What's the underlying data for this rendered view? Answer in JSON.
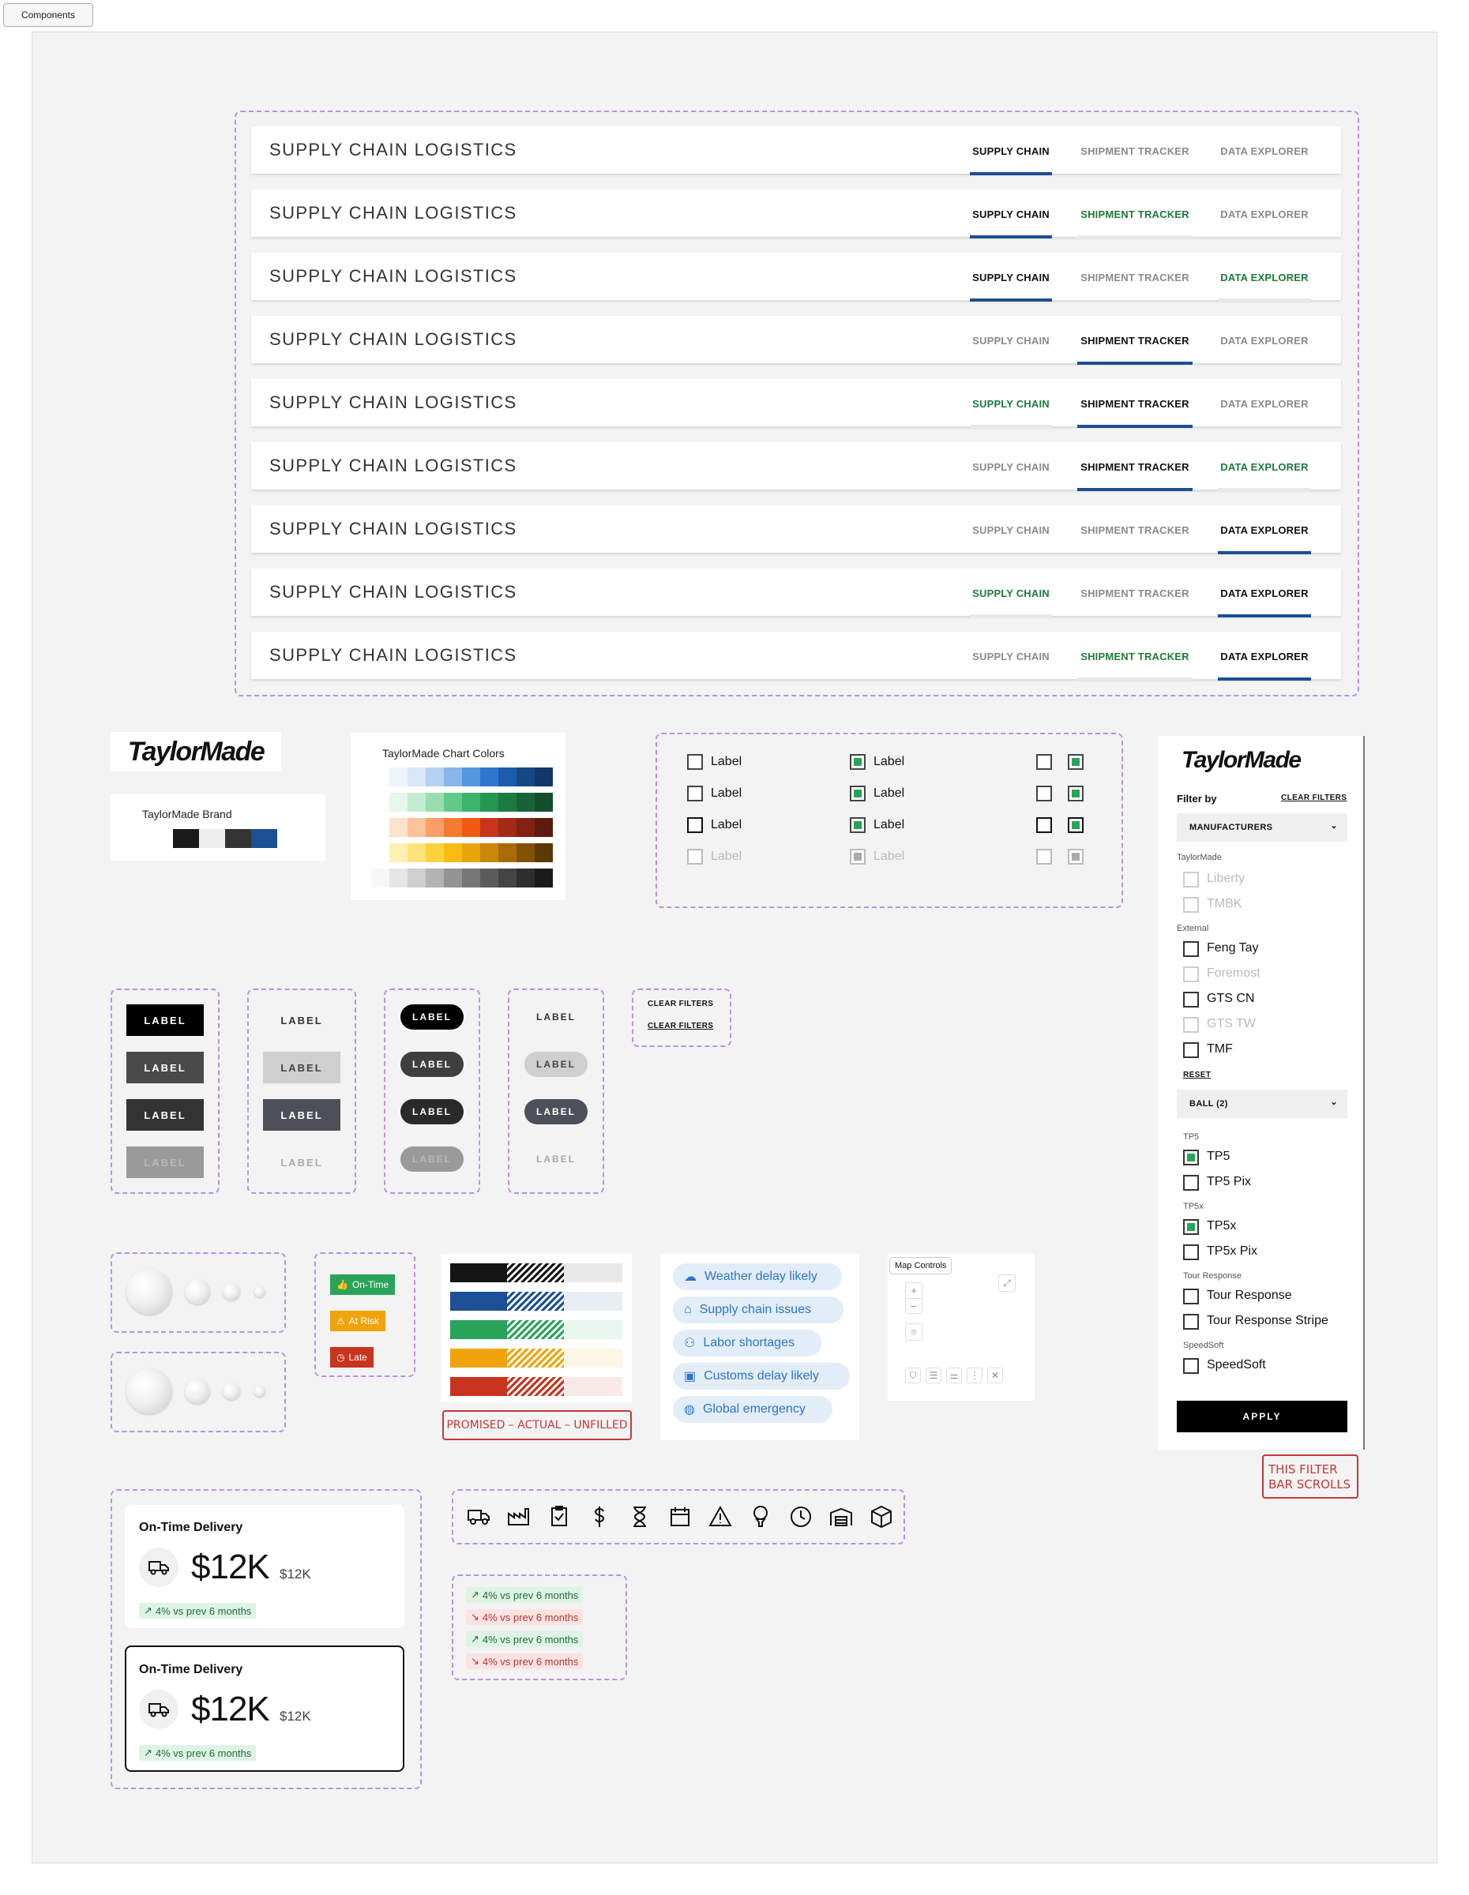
{
  "frame_tag": "Components",
  "nav": {
    "title": "SUPPLY CHAIN LOGISTICS",
    "tabs": [
      "SUPPLY CHAIN",
      "SHIPMENT TRACKER",
      "DATA EXPLORER"
    ],
    "variants": [
      {
        "states": [
          "active",
          "default",
          "default"
        ]
      },
      {
        "states": [
          "active",
          "hover",
          "default"
        ]
      },
      {
        "states": [
          "active",
          "default",
          "hover"
        ]
      },
      {
        "states": [
          "default",
          "active",
          "default"
        ]
      },
      {
        "states": [
          "hover",
          "active",
          "default"
        ]
      },
      {
        "states": [
          "default",
          "active",
          "hover"
        ]
      },
      {
        "states": [
          "default",
          "default",
          "active"
        ]
      },
      {
        "states": [
          "hover",
          "default",
          "active"
        ]
      },
      {
        "states": [
          "default",
          "hover",
          "active"
        ]
      }
    ]
  },
  "brand": {
    "logo_text": "TaylorMade",
    "brand_label": "TaylorMade Brand",
    "brand_colors": [
      "#ffffff",
      "#1a1a1a",
      "#eeeeee",
      "#333333",
      "#1c4f94"
    ],
    "chart_colors_label": "TaylorMade Chart Colors",
    "chart_palette": [
      [
        "#eef4fc",
        "#d8e6f8",
        "#b6d2f2",
        "#89b6ea",
        "#5597de",
        "#2d77cf",
        "#1c5cab",
        "#174886",
        "#12386a"
      ],
      [
        "#e6f7ec",
        "#c5ecd2",
        "#98dcb0",
        "#63c98a",
        "#3ab468",
        "#23964f",
        "#1d7a41",
        "#186336",
        "#134e2b"
      ],
      [
        "#fde2cc",
        "#fbc29c",
        "#f99e66",
        "#f57b31",
        "#f05a12",
        "#c8341d",
        "#a32a15",
        "#7f2211",
        "#5d1a0d"
      ],
      [
        "#fff0b3",
        "#ffe27a",
        "#fdd13e",
        "#f7bc14",
        "#e8a40b",
        "#cc8609",
        "#a86b07",
        "#815106",
        "#5a3904"
      ],
      [
        "#f7f7f7",
        "#e6e6e6",
        "#cfcfcf",
        "#b3b3b3",
        "#949494",
        "#777777",
        "#5c5c5c",
        "#444444",
        "#2e2e2e",
        "#1a1a1a"
      ]
    ]
  },
  "checkboxes": {
    "label": "Label"
  },
  "buttons": {
    "label": "LABEL",
    "clear_filters": "CLEAR FILTERS"
  },
  "status": {
    "on_time": "On-Time",
    "at_risk": "At Risk",
    "late": "Late"
  },
  "bars": {
    "colors": [
      "#151515",
      "#1c4f94",
      "#2aa35a",
      "#f0a30a",
      "#c8341d"
    ],
    "legend_note": "PROMISED – ACTUAL – UNFILLED"
  },
  "risks": [
    {
      "label": "Weather delay likely",
      "icon": "cloud-lightning-icon"
    },
    {
      "label": "Supply chain issues",
      "icon": "factory-icon"
    },
    {
      "label": "Labor shortages",
      "icon": "people-icon"
    },
    {
      "label": "Customs delay likely",
      "icon": "clipboard-icon"
    },
    {
      "label": "Global emergency",
      "icon": "globe-icon"
    }
  ],
  "map_controls": {
    "label": "Map Controls",
    "zoom_in": "+",
    "zoom_out": "–"
  },
  "filter": {
    "logo_text": "TaylorMade",
    "filter_by": "Filter by",
    "clear": "CLEAR FILTERS",
    "manufacturers": "MANUFACTURERS",
    "group_taylormade": "TaylorMade",
    "liberty": "Liberty",
    "tmbk": "TMBK",
    "group_external": "External",
    "feng_tay": "Feng Tay",
    "foremost": "Foremost",
    "gts_cn": "GTS CN",
    "gts_tw": "GTS TW",
    "tmf": "TMF",
    "reset": "RESET",
    "ball": "BALL (2)",
    "group_tp5": "TP5",
    "tp5": "TP5",
    "tp5_pix": "TP5 Pix",
    "group_tp5x": "TP5x",
    "tp5x": "TP5x",
    "tp5x_pix": "TP5x Pix",
    "group_tour": "Tour Response",
    "tour": "Tour Response",
    "tour_stripe": "Tour Response Stripe",
    "group_speedsoft": "SpeedSoft",
    "speedsoft": "SpeedSoft",
    "apply": "APPLY",
    "scroll_note_1": "THIS FILTER",
    "scroll_note_2": "BAR SCROLLS"
  },
  "kpi": {
    "title": "On-Time Delivery",
    "value": "$12K",
    "sub": "$12K",
    "trend": "4% vs prev 6 months"
  },
  "icons": [
    "truck-icon",
    "factory-icon",
    "clipboard-check-icon",
    "dollar-icon",
    "hourglass-icon",
    "calendar-icon",
    "warning-icon",
    "golf-ball-tee-icon",
    "clock-icon",
    "warehouse-icon",
    "box-icon"
  ],
  "trends": {
    "label": "4% vs prev 6 months",
    "dirs": [
      "up",
      "down",
      "up",
      "down"
    ]
  }
}
